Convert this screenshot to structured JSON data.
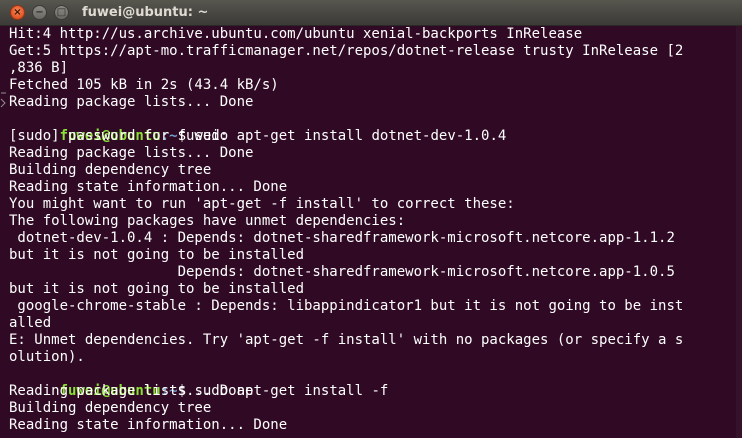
{
  "window": {
    "title": "fuwei@ubuntu: ~",
    "close_glyph": "×",
    "minimize_glyph": "−",
    "maximize_glyph": "□"
  },
  "prompt": {
    "user_host": "fuwei@ubuntu",
    "path": ":~",
    "symbol": "$ "
  },
  "terminal": {
    "lines": [
      "Hit:4 http://us.archive.ubuntu.com/ubuntu xenial-backports InRelease",
      "Get:5 https://apt-mo.trafficmanager.net/repos/dotnet-release trusty InRelease [2",
      ",836 B]",
      "Fetched 105 kB in 2s (43.4 kB/s)",
      "Reading package lists... Done",
      "sudo apt-get install dotnet-dev-1.0.4",
      "[sudo] password for fuwei:",
      "Reading package lists... Done",
      "Building dependency tree",
      "Reading state information... Done",
      "You might want to run 'apt-get -f install' to correct these:",
      "The following packages have unmet dependencies:",
      " dotnet-dev-1.0.4 : Depends: dotnet-sharedframework-microsoft.netcore.app-1.1.2",
      "but it is not going to be installed",
      "                    Depends: dotnet-sharedframework-microsoft.netcore.app-1.0.5",
      "but it is not going to be installed",
      " google-chrome-stable : Depends: libappindicator1 but it is not going to be inst",
      "alled",
      "E: Unmet dependencies. Try 'apt-get -f install' with no packages (or specify a s",
      "olution).",
      "sudo apt-get install -f",
      "Reading package lists... Done",
      "Building dependency tree",
      "Reading state information... Done"
    ]
  },
  "colors": {
    "background": "#300a24",
    "prompt_user": "#8ae234",
    "prompt_path": "#729fcf",
    "text": "#ffffff",
    "titlebar": "#3c3b37"
  }
}
